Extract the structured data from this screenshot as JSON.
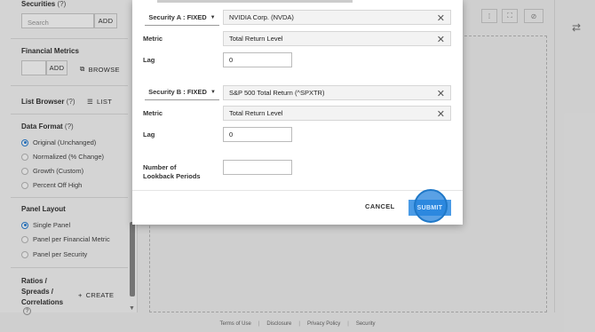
{
  "sidebar": {
    "securities": {
      "title": "Securities",
      "help": "(?)",
      "search_placeholder": "Search",
      "add_label": "ADD"
    },
    "financial_metrics": {
      "title": "Financial Metrics",
      "add_label": "ADD",
      "browse_label": "BROWSE"
    },
    "list_browser": {
      "title": "List Browser",
      "help": "(?)",
      "list_label": "LIST"
    },
    "data_format": {
      "title": "Data Format",
      "help": "(?)",
      "options": [
        "Original (Unchanged)",
        "Normalized (% Change)",
        "Growth (Custom)",
        "Percent Off High"
      ],
      "selected_index": 0
    },
    "panel_layout": {
      "title": "Panel Layout",
      "options": [
        "Single Panel",
        "Panel per Financial Metric",
        "Panel per Security"
      ],
      "selected_index": 0
    },
    "ratios": {
      "title_line1": "Ratios /",
      "title_line2": "Spreads /",
      "title_line3": "Correlations",
      "help": "?",
      "create_label": "CREATE"
    }
  },
  "footer": {
    "links": [
      "Terms of Use",
      "Disclosure",
      "Privacy Policy",
      "Security"
    ],
    "separator": "|"
  },
  "modal": {
    "security_a": {
      "selector_label": "Security A : FIXED",
      "value": "NVIDIA Corp. (NVDA)"
    },
    "metric_a": {
      "label": "Metric",
      "value": "Total Return Level"
    },
    "lag_a": {
      "label": "Lag",
      "value": "0"
    },
    "security_b": {
      "selector_label": "Security B : FIXED",
      "value": "S&P 500 Total Return (^SPXTR)"
    },
    "metric_b": {
      "label": "Metric",
      "value": "Total Return Level"
    },
    "lag_b": {
      "label": "Lag",
      "value": "0"
    },
    "lookback": {
      "label_line1": "Number of",
      "label_line2": "Lookback Periods",
      "value": ""
    },
    "cancel_label": "CANCEL",
    "submit_label": "SUBMIT"
  },
  "colors": {
    "accent": "#2a7fd4",
    "submit_bg": "#4a9be6",
    "click_indicator": "#1f78c8"
  },
  "icons": {
    "remove": "close-icon",
    "dropdown": "caret-down-icon",
    "browse": "browse-icon",
    "list": "list-icon",
    "create": "plus-icon",
    "settings": "sliders-icon",
    "fullscreen": "expand-icon",
    "hide": "eye-slash-icon"
  }
}
